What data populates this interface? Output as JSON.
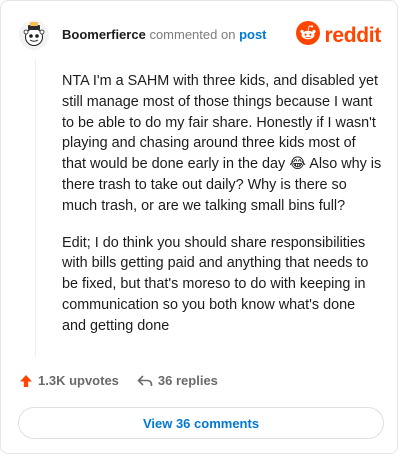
{
  "header": {
    "username": "Boomerfierce",
    "action_text": "commented on",
    "post_link": "post",
    "brand_name": "reddit"
  },
  "comment": {
    "paragraphs": [
      "NTA I'm a SAHM with three kids, and disabled yet still manage most of those things because I want to be able to do my fair share. Honestly if I wasn't playing and chasing around three kids most of that would be done early in the day 😂 Also why is there trash to take out daily? Why is there so much trash, or are we talking small bins full?",
      "Edit; I do think you should share responsibilities with bills getting paid and anything that needs to be fixed, but that's moreso to do with keeping in communication so you both know what's done and getting done"
    ]
  },
  "footer": {
    "upvotes": "1.3K upvotes",
    "replies": "36 replies",
    "view_comments": "View 36 comments"
  },
  "colors": {
    "brand": "#ff4500",
    "link": "#0079d3",
    "muted": "#7c7c7c"
  },
  "icons": {
    "avatar": "snoo-avatar-icon",
    "brand": "reddit-logo-icon",
    "upvote": "upvote-arrow-icon",
    "reply": "reply-arrow-icon"
  }
}
